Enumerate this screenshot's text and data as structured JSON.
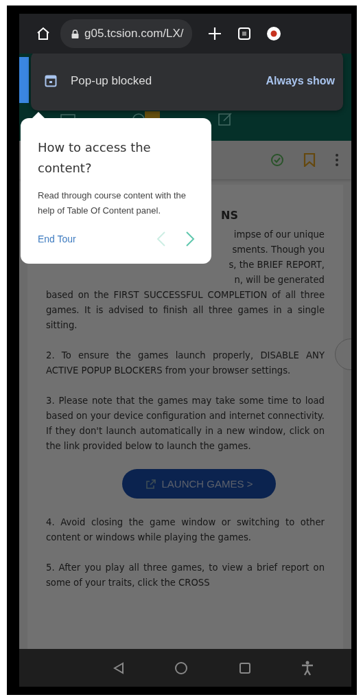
{
  "browser": {
    "url": "g05.tcsion.com/LX/"
  },
  "popup_notice": {
    "message": "Pop-up blocked",
    "action": "Always show"
  },
  "tour": {
    "title": "How to access the content?",
    "body": "Read through course content with the help of Table Of Content panel.",
    "end_label": "End Tour",
    "prev_disabled": true
  },
  "content": {
    "heading_fragment": "NS",
    "line_fragments": [
      "impse of our unique",
      "sments. Though you",
      "s, the BRIEF REPORT,",
      "n, will be generated"
    ],
    "paragraphs_before": [
      "based on the FIRST SUCCESSFUL COMPLETION of all three games. It is advised to finish all three games in a single sitting.",
      "2. To ensure the games launch properly, DISABLE ANY ACTIVE POPUP BLOCKERS from your browser settings.",
      "3. Please note that the games may take some time to load based on your device configuration and internet connectivity. If they don't launch automatically in a new window, click on the link provided below to launch the games."
    ],
    "button_label": "LAUNCH GAMES >",
    "paragraphs_after": [
      "4. Avoid closing the game window or switching to other content or windows while playing the games.",
      "5. After you play all three games, to view a brief report on some of your traits, click the CROSS"
    ]
  }
}
